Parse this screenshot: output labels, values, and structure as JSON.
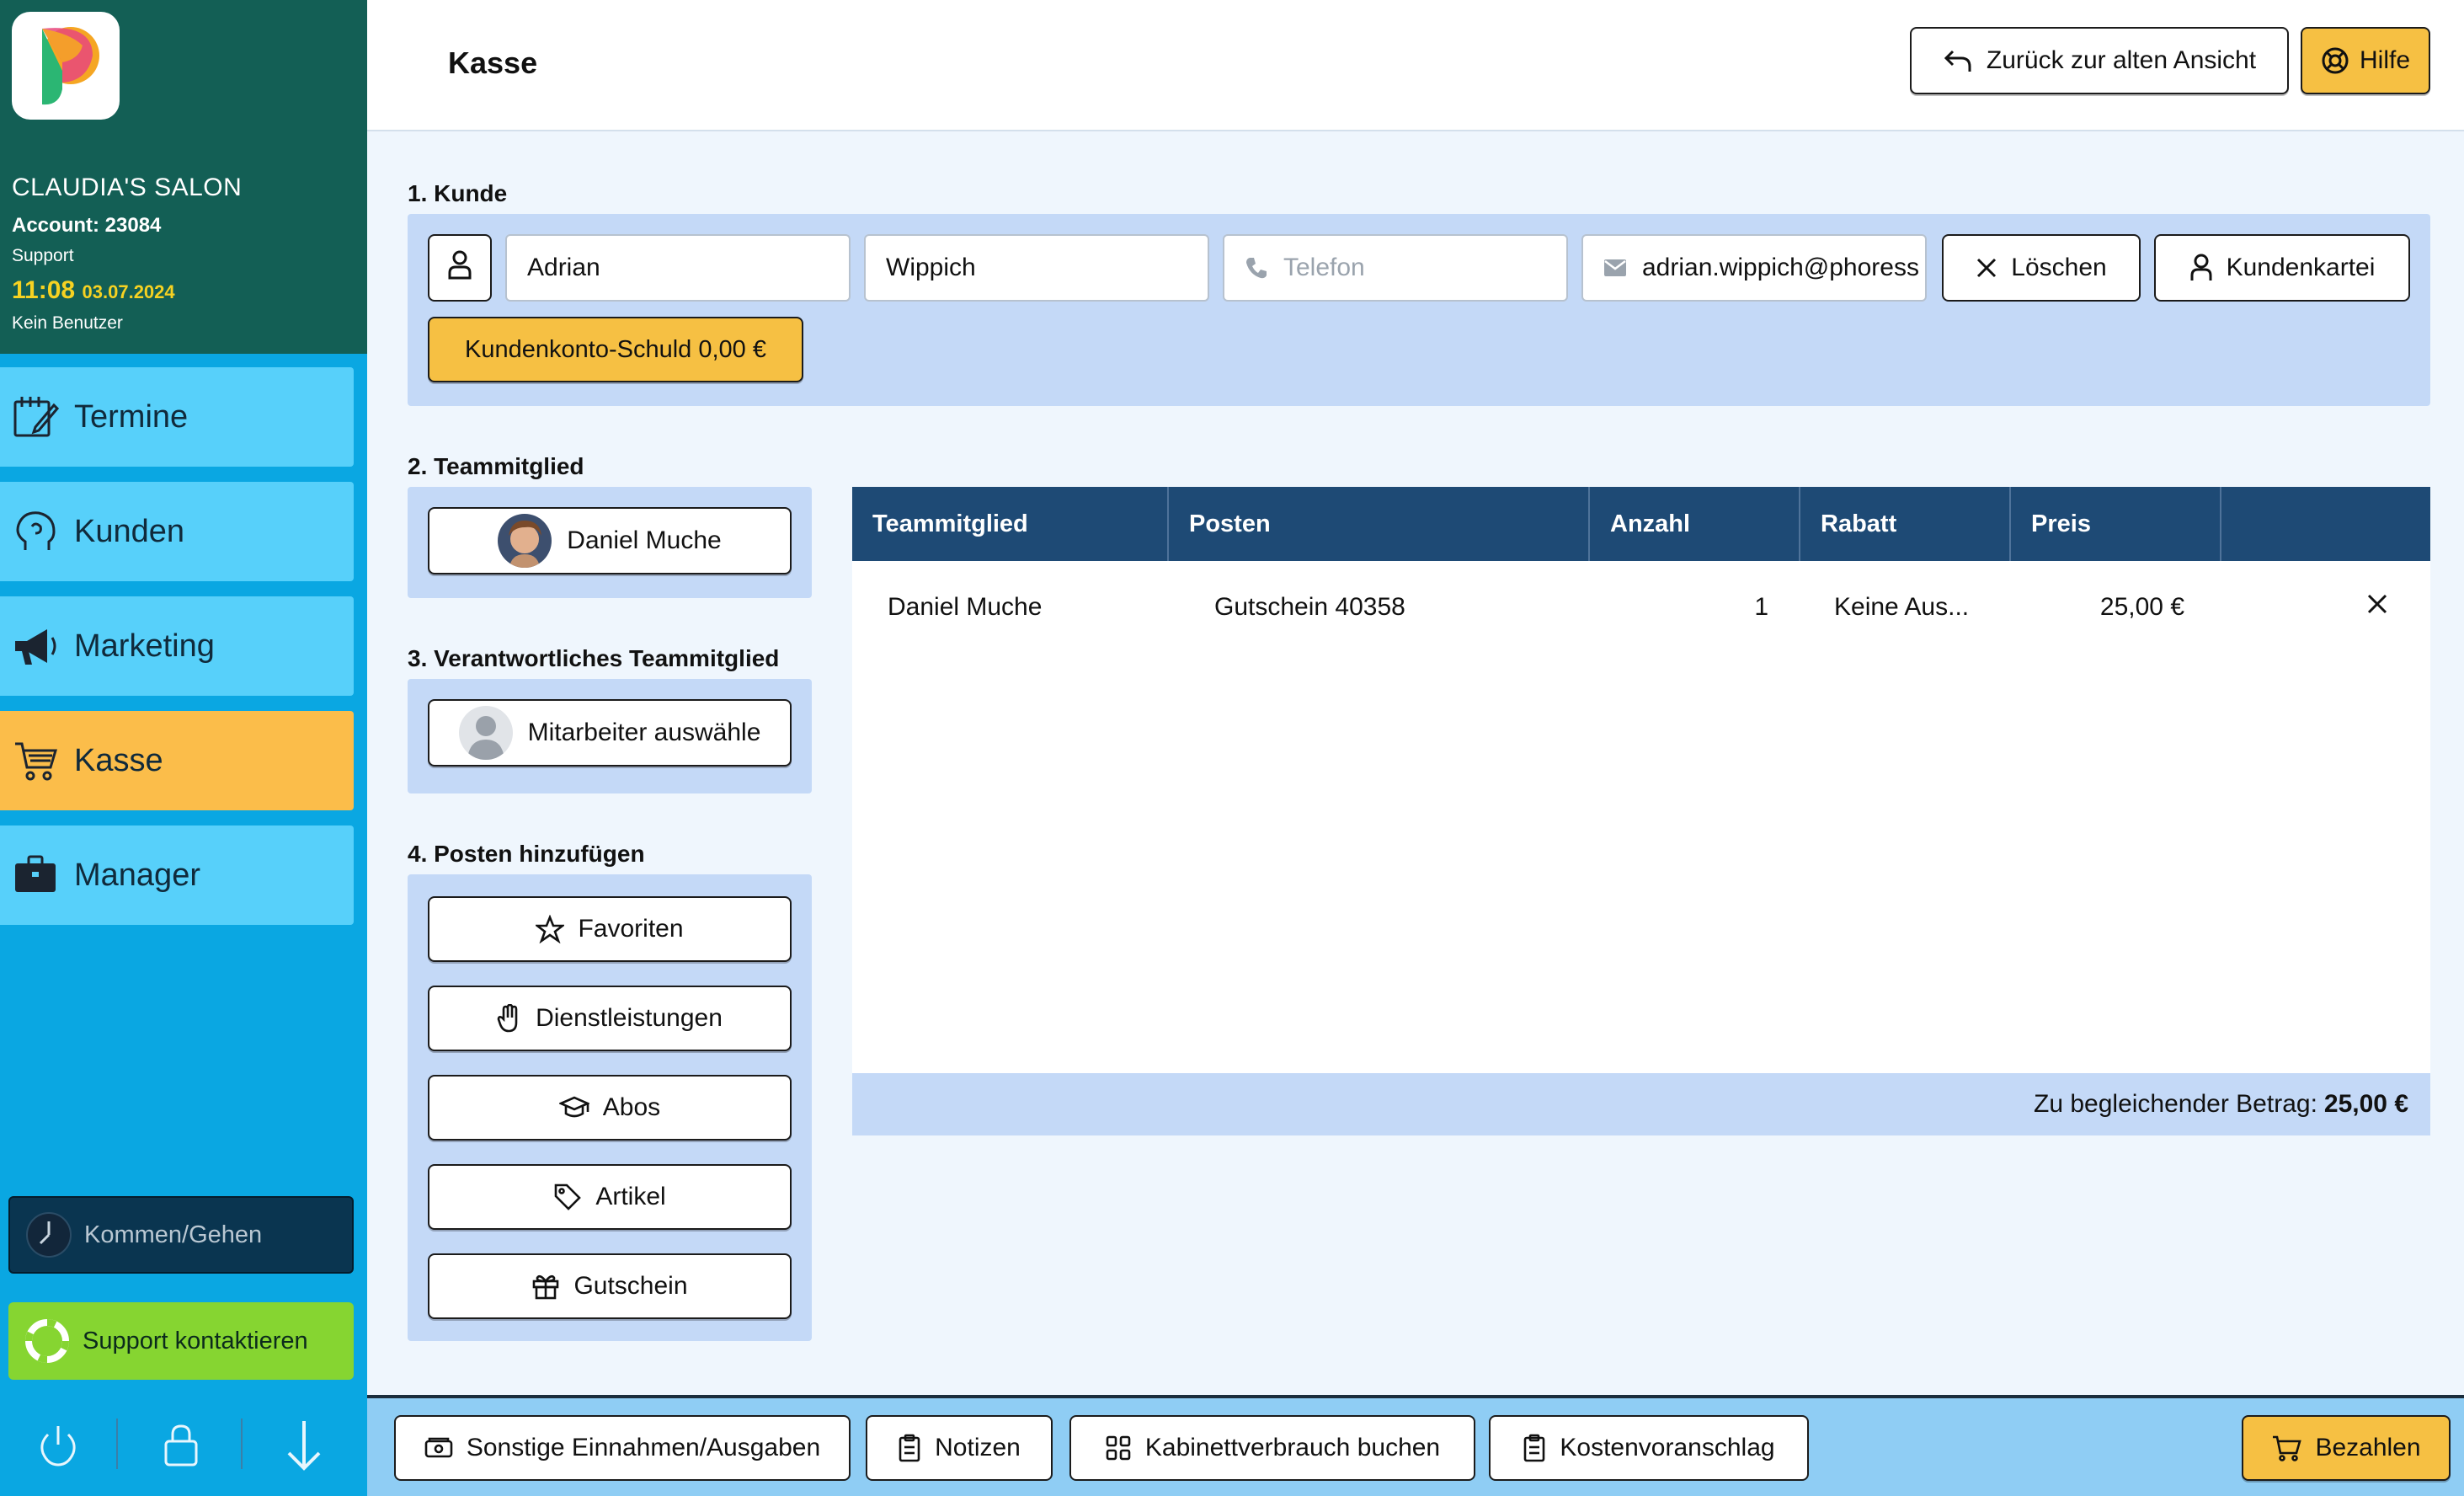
{
  "sidebar": {
    "salon_name": "CLAUDIA'S SALON",
    "account": "Account: 23084",
    "role": "Support",
    "time": "11:08",
    "date": "03.07.2024",
    "user": "Kein Benutzer",
    "nav": [
      {
        "label": "Termine",
        "icon": "calendar-edit-icon"
      },
      {
        "label": "Kunden",
        "icon": "customer-head-icon"
      },
      {
        "label": "Marketing",
        "icon": "megaphone-icon"
      },
      {
        "label": "Kasse",
        "icon": "cart-icon",
        "active": true
      },
      {
        "label": "Manager",
        "icon": "briefcase-icon"
      }
    ],
    "kommen_gehen": "Kommen/Gehen",
    "support": "Support kontaktieren"
  },
  "header": {
    "title": "Kasse",
    "back_label": "Zurück zur alten Ansicht",
    "help_label": "Hilfe"
  },
  "customer": {
    "section": "1. Kunde",
    "first_name": "Adrian",
    "last_name": "Wippich",
    "phone_placeholder": "Telefon",
    "email": "adrian.wippich@phoress",
    "delete_label": "Löschen",
    "file_label": "Kundenkartei",
    "debt_label": "Kundenkonto-Schuld 0,00 €"
  },
  "team": {
    "section": "2. Teammitglied",
    "member": "Daniel Muche"
  },
  "responsible": {
    "section": "3. Verantwortliches Teammitglied",
    "select_label": "Mitarbeiter auswähle"
  },
  "items": {
    "section": "4. Posten hinzufügen",
    "buttons": [
      {
        "label": "Favoriten",
        "icon": "star-icon"
      },
      {
        "label": "Dienstleistungen",
        "icon": "hand-icon"
      },
      {
        "label": "Abos",
        "icon": "graduation-cap-icon"
      },
      {
        "label": "Artikel",
        "icon": "tag-icon"
      },
      {
        "label": "Gutschein",
        "icon": "gift-icon"
      }
    ]
  },
  "table": {
    "columns": [
      "Teammitglied",
      "Posten",
      "Anzahl",
      "Rabatt",
      "Preis",
      ""
    ],
    "rows": [
      {
        "member": "Daniel Muche",
        "item": "Gutschein 40358",
        "qty": "1",
        "discount": "Keine Aus...",
        "price": "25,00 €"
      }
    ],
    "total_label": "Zu begleichender Betrag:",
    "total_value": "25,00 €"
  },
  "bottom": {
    "other": "Sonstige Einnahmen/Ausgaben",
    "notes": "Notizen",
    "cabinet": "Kabinettverbrauch buchen",
    "estimate": "Kostenvoranschlag",
    "pay": "Bezahlen"
  },
  "colors": {
    "sidebar": "#0aa7e2",
    "brand": "#135f55",
    "nav": "#57d0fa",
    "active": "#fbbd4a",
    "table_head": "#1e4a75",
    "panel": "#c4d9f7"
  }
}
